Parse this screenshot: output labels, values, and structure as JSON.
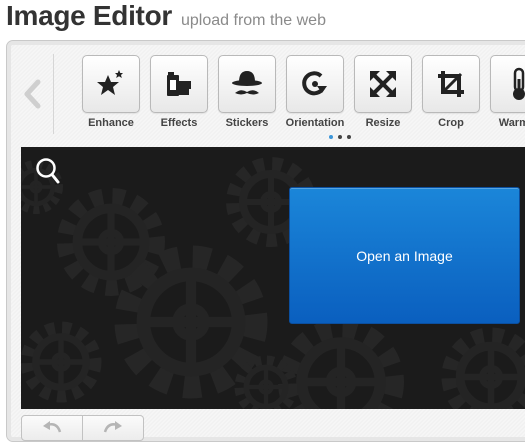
{
  "header": {
    "title": "Image Editor",
    "subtitle": "upload from the web"
  },
  "tools": [
    {
      "label": "Enhance",
      "icon": "enhance-icon"
    },
    {
      "label": "Effects",
      "icon": "effects-icon"
    },
    {
      "label": "Stickers",
      "icon": "stickers-icon"
    },
    {
      "label": "Orientation",
      "icon": "orientation-icon"
    },
    {
      "label": "Resize",
      "icon": "resize-icon"
    },
    {
      "label": "Crop",
      "icon": "crop-icon"
    },
    {
      "label": "Warmth",
      "icon": "warmth-icon"
    }
  ],
  "carousel": {
    "pages": 3,
    "current": 1
  },
  "canvas": {
    "open_button": "Open an Image"
  },
  "colors": {
    "accent": "#1b86d9",
    "canvas_bg": "#1b1b1b",
    "active_dot": "#3b95d8"
  }
}
